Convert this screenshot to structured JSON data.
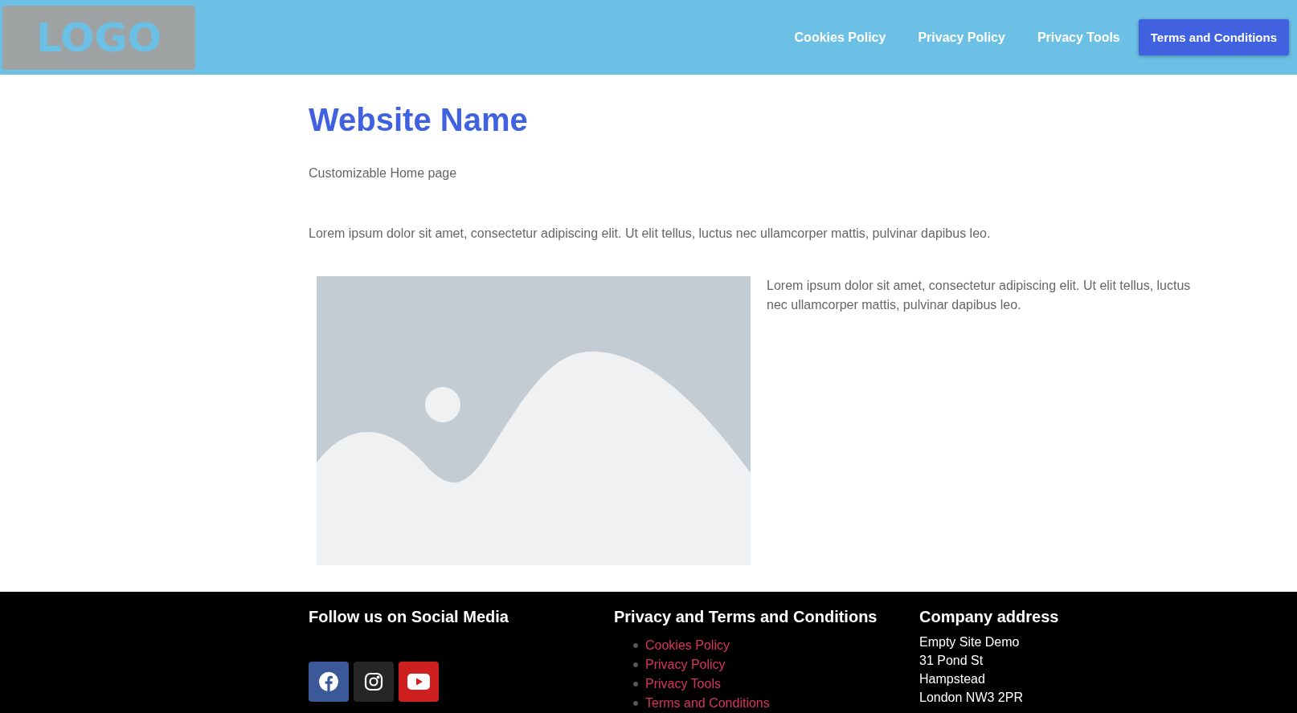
{
  "header": {
    "logo": "LOGO",
    "nav": [
      {
        "label": "Cookies Policy",
        "selected": false
      },
      {
        "label": "Privacy Policy",
        "selected": false
      },
      {
        "label": "Privacy Tools",
        "selected": false
      },
      {
        "label": "Terms and Conditions",
        "selected": true
      }
    ]
  },
  "main": {
    "title": "Website Name",
    "subtitle": "Customizable Home page",
    "intro": "Lorem ipsum dolor sit amet, consectetur adipiscing elit. Ut elit tellus, luctus nec ullamcorper mattis, pulvinar dapibus leo.",
    "side_text": "Lorem ipsum dolor sit amet, consectetur adipiscing elit. Ut elit tellus, luctus nec ullamcorper mattis, pulvinar dapibus leo."
  },
  "footer": {
    "social": {
      "heading": "Follow us on Social Media",
      "icons": [
        {
          "kind": "facebook",
          "color": "#3b5998"
        },
        {
          "kind": "instagram",
          "color": "#262626"
        },
        {
          "kind": "youtube",
          "color": "#cd201f"
        }
      ]
    },
    "legal": {
      "heading": "Privacy and Terms and Conditions",
      "links": [
        "Cookies Policy",
        "Privacy Policy",
        "Privacy Tools",
        "Terms and Conditions"
      ]
    },
    "address": {
      "heading": "Company address",
      "lines": [
        "Empty Site Demo",
        "31 Pond St",
        "Hampstead",
        "London NW3 2PR"
      ]
    }
  }
}
